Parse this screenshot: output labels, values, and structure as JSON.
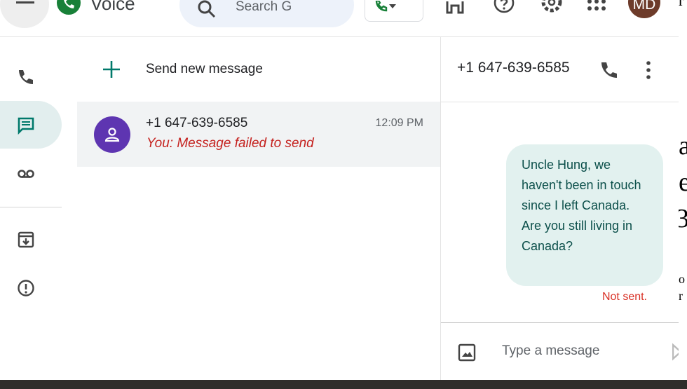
{
  "app": {
    "title": "Voice"
  },
  "colors": {
    "accent": "#188038",
    "failed": "#c5221f",
    "bubble": "#e2f1ef"
  },
  "header": {
    "search_placeholder": "Search G",
    "avatar_initials": "MD",
    "icons": [
      "menu-icon",
      "search-icon",
      "phone-icon",
      "chevron-down-icon",
      "headset-icon",
      "help-icon",
      "settings-icon",
      "apps-icon"
    ]
  },
  "nav": {
    "items": [
      {
        "name": "calls",
        "icon": "phone-icon",
        "active": false
      },
      {
        "name": "messages",
        "icon": "message-icon",
        "active": true
      },
      {
        "name": "voicemail",
        "icon": "voicemail-icon",
        "active": false
      },
      {
        "name": "archive",
        "icon": "archive-icon",
        "active": false
      },
      {
        "name": "spam",
        "icon": "spam-icon",
        "active": false
      }
    ]
  },
  "list": {
    "new_message": "Send new message",
    "conversations": [
      {
        "name": "+1 647-639-6585",
        "time": "12:09 PM",
        "snippet": "You: Message failed to send"
      }
    ]
  },
  "thread": {
    "contact": "+1 647-639-6585",
    "message": "Uncle Hung, we haven't been in touch since I left Canada. Are you still living in Canada?",
    "status": "Not sent."
  },
  "composer": {
    "placeholder": "Type a message"
  },
  "background_fragments": [
    "a",
    "e",
    "3",
    "o",
    "r"
  ]
}
